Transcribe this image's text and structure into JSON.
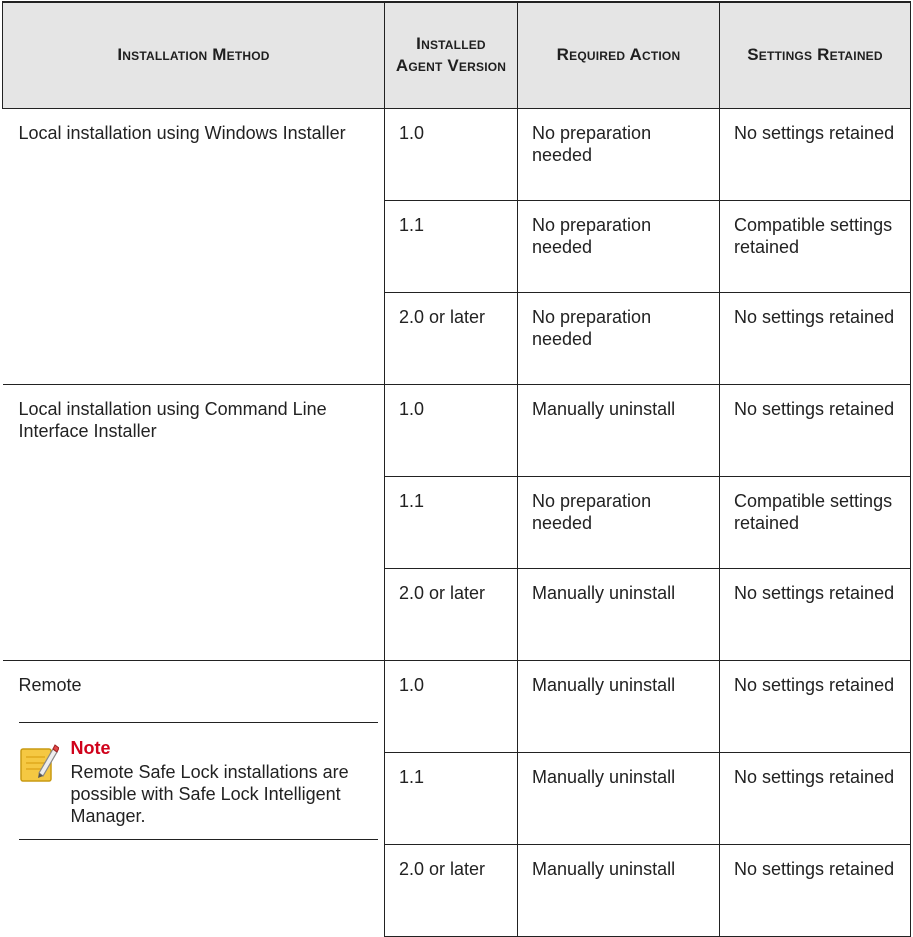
{
  "headers": {
    "method": "Installation Method",
    "version": "Installed Agent Version",
    "action": "Required Action",
    "settings": "Settings Retained"
  },
  "groups": [
    {
      "method": "Local installation using Windows Installer",
      "rows": [
        {
          "version": "1.0",
          "action": "No preparation needed",
          "settings": "No settings retained"
        },
        {
          "version": "1.1",
          "action": "No preparation needed",
          "settings": "Compatible settings retained"
        },
        {
          "version": "2.0 or later",
          "action": "No preparation needed",
          "settings": "No settings retained"
        }
      ]
    },
    {
      "method": "Local installation using Command Line Interface Installer",
      "rows": [
        {
          "version": "1.0",
          "action": "Manually uninstall",
          "settings": "No settings retained"
        },
        {
          "version": "1.1",
          "action": "No preparation needed",
          "settings": "Compatible settings retained"
        },
        {
          "version": "2.0 or later",
          "action": "Manually uninstall",
          "settings": "No settings retained"
        }
      ]
    },
    {
      "method": "Remote",
      "note": {
        "icon": "note-pencil-icon",
        "title": "Note",
        "text": "Remote Safe Lock installations are possible with Safe Lock Intelligent Manager."
      },
      "rows": [
        {
          "version": "1.0",
          "action": "Manually uninstall",
          "settings": "No settings retained"
        },
        {
          "version": "1.1",
          "action": "Manually uninstall",
          "settings": "No settings retained"
        },
        {
          "version": "2.0 or later",
          "action": "Manually uninstall",
          "settings": "No settings retained"
        }
      ]
    }
  ],
  "colors": {
    "header_bg": "#e5e5e5",
    "note_title": "#d0021b",
    "note_icon": "#f5c842"
  }
}
